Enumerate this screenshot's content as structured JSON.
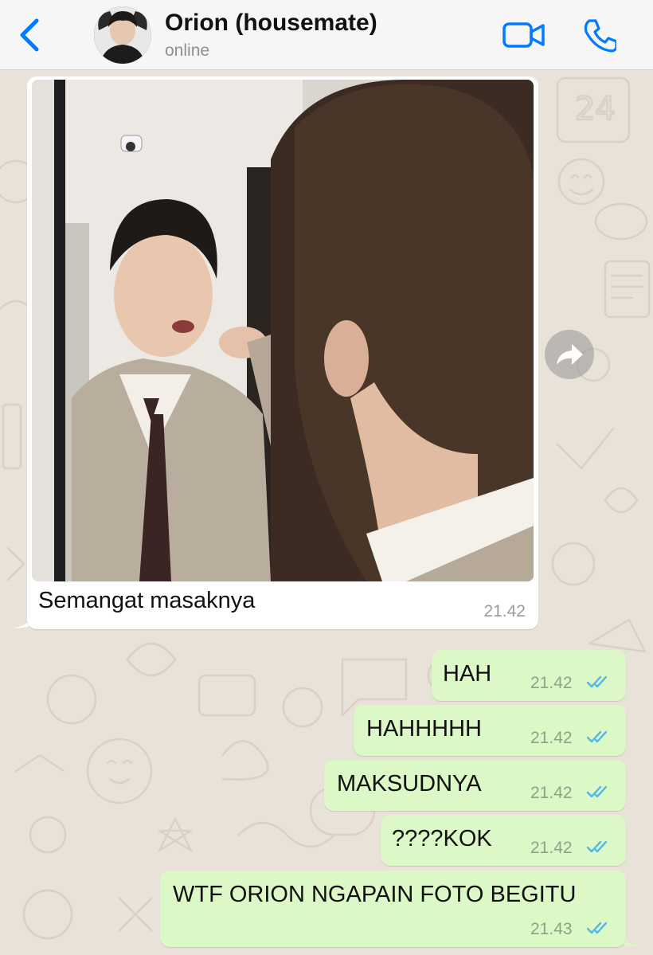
{
  "header": {
    "contact_name": "Orion (housemate)",
    "status": "online",
    "accent_color": "#007aff"
  },
  "icons": {
    "back": "chevron-left-icon",
    "video": "video-camera-icon",
    "call": "phone-icon",
    "forward": "forward-arrow-icon",
    "read_receipt": "double-check-icon"
  },
  "messages": [
    {
      "direction": "incoming",
      "type": "image",
      "caption": "Semangat masaknya",
      "time": "21.42"
    },
    {
      "direction": "outgoing",
      "text": "HAH",
      "time": "21.42",
      "read": true
    },
    {
      "direction": "outgoing",
      "text": "HAHHHHH",
      "time": "21.42",
      "read": true
    },
    {
      "direction": "outgoing",
      "text": "MAKSUDNYA",
      "time": "21.42",
      "read": true
    },
    {
      "direction": "outgoing",
      "text": "????KOK",
      "time": "21.42",
      "read": true
    },
    {
      "direction": "outgoing",
      "text": "WTF ORION NGAPAIN FOTO BEGITU",
      "time": "21.43",
      "read": true
    }
  ],
  "colors": {
    "outgoing_bubble": "#dcf8c6",
    "incoming_bubble": "#ffffff",
    "read_tick": "#4fb6ec",
    "wallpaper": "#e9e2d8"
  }
}
